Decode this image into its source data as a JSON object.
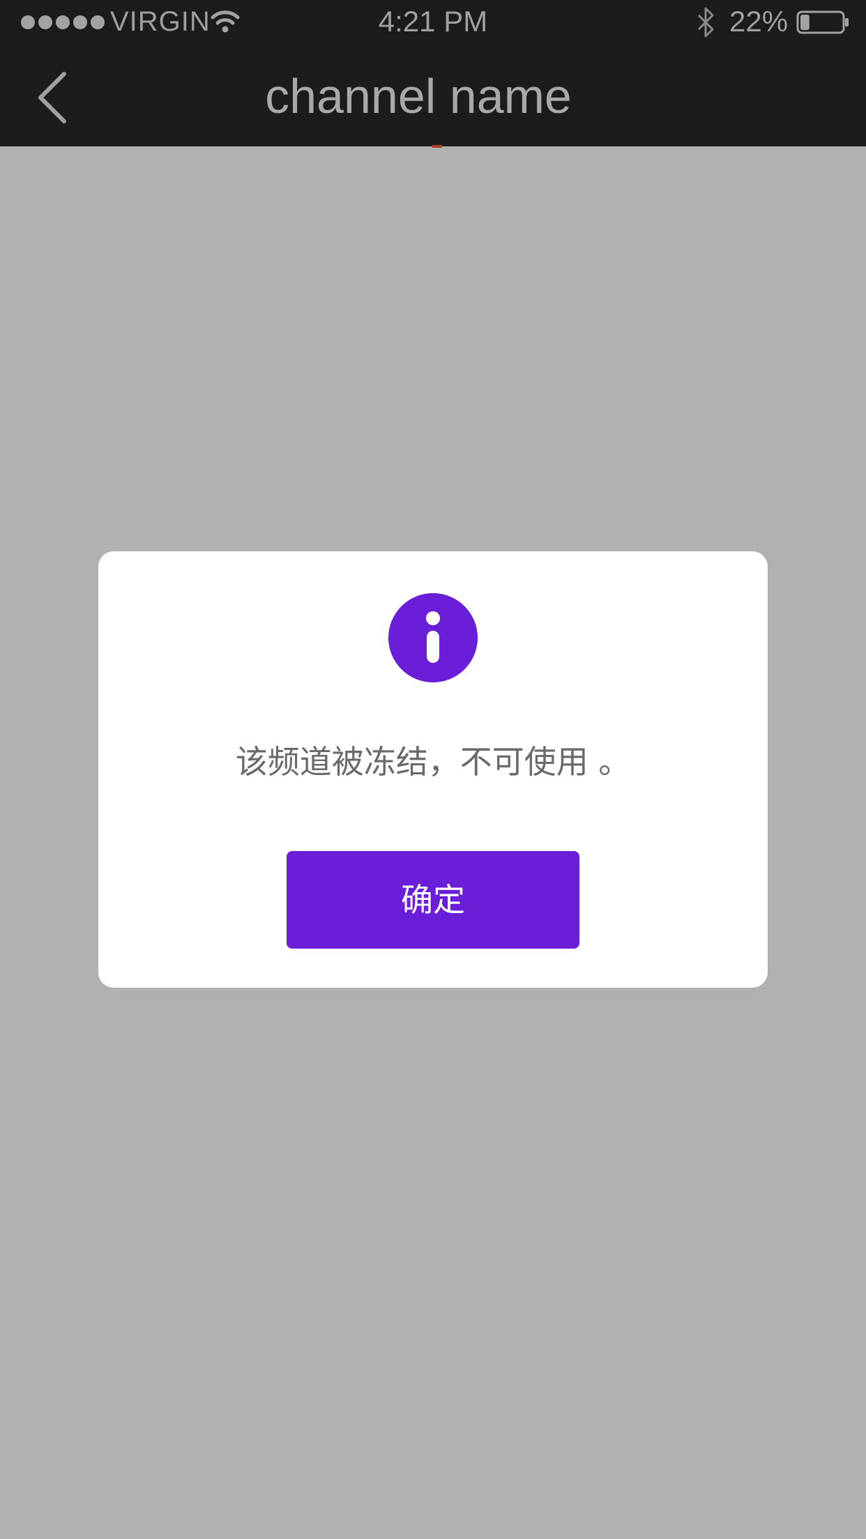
{
  "status_bar": {
    "carrier": "VIRGIN",
    "signal_bars": 5,
    "time": "4:21 PM",
    "battery_percent": "22%",
    "battery_level": 0.22,
    "icons": [
      "signal-dots-icon",
      "wifi-icon",
      "bluetooth-icon",
      "battery-icon"
    ]
  },
  "nav": {
    "title": "channel name",
    "back_icon": "chevron-left-icon"
  },
  "dialog": {
    "icon": "info-icon",
    "message": "该频道被冻结，不可使用 。",
    "confirm_label": "确定"
  },
  "colors": {
    "accent": "#6b1ed8",
    "top_bar": "#1c1c1c",
    "overlay": "#b1b1b1",
    "dialog_bg": "#ffffff"
  }
}
